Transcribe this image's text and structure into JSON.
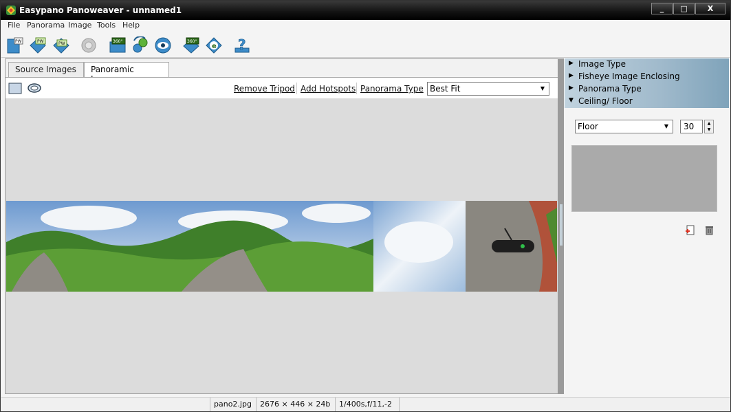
{
  "window": {
    "title": "Easypano Panoweaver - unnamed1",
    "minimize": "_",
    "maximize": "□",
    "close": "X"
  },
  "menu": [
    "File",
    "Panorama",
    "Image",
    "Tools",
    "Help"
  ],
  "toolbar": {
    "buttons": [
      "new-project",
      "open-project",
      "save-project",
      "stitch",
      "publish-360",
      "rotate-tool",
      "preview",
      "publish-flash",
      "publish-web",
      "help"
    ],
    "badges": {
      "pw": "PW",
      "deg360": "360°",
      "e": "e",
      "q": "?"
    }
  },
  "tabs": [
    "Source Images",
    "Panoramic Image"
  ],
  "subbar": {
    "remove_tripod": "Remove Tripod",
    "add_hotspots": "Add Hotspots",
    "panorama_type": "Panorama Type",
    "view_mode": "Best Fit"
  },
  "accordion": [
    {
      "label": "Image Type",
      "expanded": false
    },
    {
      "label": "Fisheye Image Enclosing",
      "expanded": false
    },
    {
      "label": "Panorama Type",
      "expanded": false
    },
    {
      "label": "Ceiling/ Floor",
      "expanded": true
    }
  ],
  "ceiling_floor": {
    "mode": "Floor",
    "value": "30"
  },
  "status": {
    "filename": "pano2.jpg",
    "dimensions": "2676 × 446 × 24b",
    "exposure": "1/400s,f/11,-2"
  },
  "colors": {
    "accent": "#4d87b8",
    "title_bar": "#111111",
    "canvas": "#dcdcdc"
  }
}
